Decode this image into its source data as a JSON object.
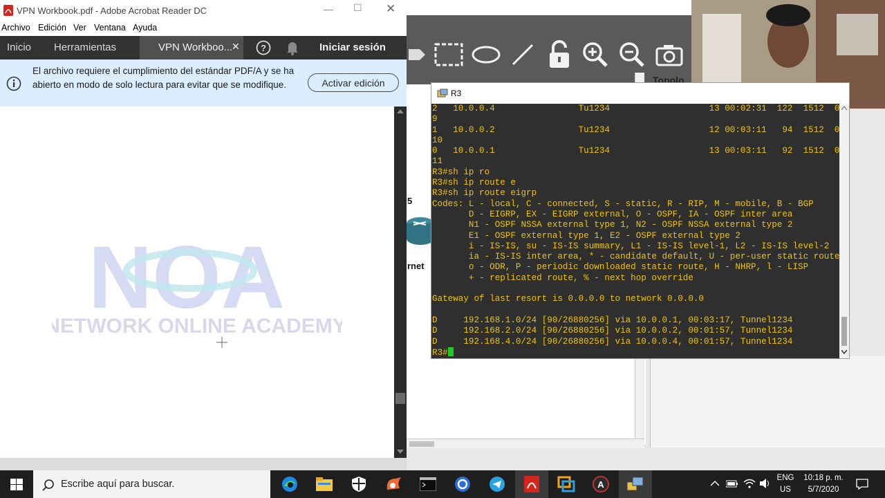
{
  "acrobat": {
    "title": "VPN Workbook.pdf - Adobe Acrobat Reader DC",
    "menu": [
      "Archivo",
      "Edición",
      "Ver",
      "Ventana",
      "Ayuda"
    ],
    "tabs": {
      "home": "Inicio",
      "tools": "Herramientas",
      "document": "VPN Workboo...",
      "signin": "Iniciar sesión"
    },
    "notice": {
      "text": "El archivo requiere el cumplimiento del estándar PDF/A y se ha abierto en modo de solo lectura para evitar que se modifique.",
      "button": "Activar edición"
    },
    "watermark": {
      "logo": "NOA",
      "text": "NETWORK ONLINE ACADEMY"
    }
  },
  "gns3": {
    "topology_label": "Topolo",
    "router_label": "5",
    "cloud_label": "rnet"
  },
  "terminal": {
    "title": "R3",
    "lines": [
      "2   10.0.0.4                Tu1234                   13 00:02:31  122  1512  0",
      "9",
      "1   10.0.0.2                Tu1234                   12 00:03:11   94  1512  0",
      "10",
      "0   10.0.0.1                Tu1234                   13 00:03:11   92  1512  0",
      "11",
      "R3#sh ip ro",
      "R3#sh ip route e",
      "R3#sh ip route eigrp",
      "Codes: L - local, C - connected, S - static, R - RIP, M - mobile, B - BGP",
      "       D - EIGRP, EX - EIGRP external, O - OSPF, IA - OSPF inter area",
      "       N1 - OSPF NSSA external type 1, N2 - OSPF NSSA external type 2",
      "       E1 - OSPF external type 1, E2 - OSPF external type 2",
      "       i - IS-IS, su - IS-IS summary, L1 - IS-IS level-1, L2 - IS-IS level-2",
      "       ia - IS-IS inter area, * - candidate default, U - per-user static route",
      "       o - ODR, P - periodic downloaded static route, H - NHRP, l - LISP",
      "       + - replicated route, % - next hop override",
      "",
      "Gateway of last resort is 0.0.0.0 to network 0.0.0.0",
      "",
      "D     192.168.1.0/24 [90/26880256] via 10.0.0.1, 00:03:17, Tunnel1234",
      "D     192.168.2.0/24 [90/26880256] via 10.0.0.2, 00:01:57, Tunnel1234",
      "D     192.168.4.0/24 [90/26880256] via 10.0.0.4, 00:01:57, Tunnel1234"
    ],
    "prompt": "R3#"
  },
  "taskbar": {
    "search_placeholder": "Escribe aquí para buscar.",
    "lang": "ENG",
    "region": "US",
    "time": "10:18 p. m.",
    "date": "5/7/2020"
  },
  "colors": {
    "terminal_bg": "#2f2f2f",
    "terminal_fg": "#f0c400",
    "acrobat_tabbar": "#323232",
    "notice_bg": "#dbeeff",
    "taskbar_bg": "#1e1e1e"
  }
}
